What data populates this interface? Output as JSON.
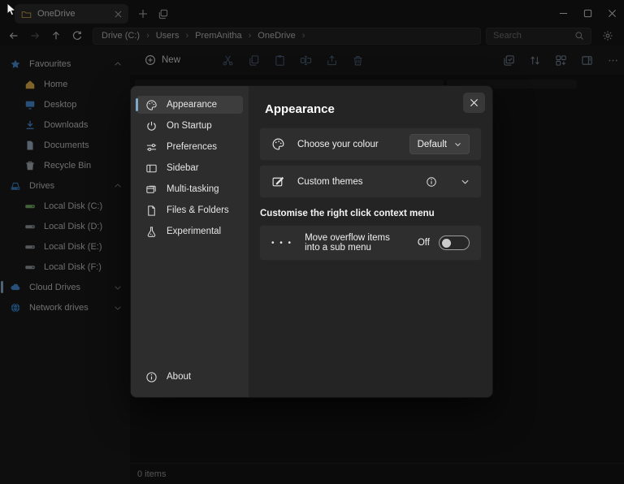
{
  "titlebar": {
    "tab_title": "OneDrive"
  },
  "addressbar": {
    "breadcrumb": {
      "items": [
        "Drive (C:)",
        "Users",
        "PremAnitha",
        "OneDrive"
      ],
      "separator": "›"
    },
    "search": {
      "placeholder": "Search"
    }
  },
  "toolbar": {
    "new_label": "New"
  },
  "sidebar": {
    "favourites": {
      "label": "Favourites",
      "items": [
        {
          "label": "Home"
        },
        {
          "label": "Desktop"
        },
        {
          "label": "Downloads"
        },
        {
          "label": "Documents"
        },
        {
          "label": "Recycle Bin"
        }
      ]
    },
    "drives": {
      "label": "Drives",
      "items": [
        {
          "label": "Local Disk (C:)"
        },
        {
          "label": "Local Disk (D:)"
        },
        {
          "label": "Local Disk (E:)"
        },
        {
          "label": "Local Disk (F:)"
        }
      ]
    },
    "cloud": {
      "label": "Cloud Drives"
    },
    "network": {
      "label": "Network drives"
    }
  },
  "statusbar": {
    "count": "0 items"
  },
  "settings": {
    "nav": {
      "items": [
        {
          "label": "Appearance",
          "selected": true
        },
        {
          "label": "On Startup",
          "selected": false
        },
        {
          "label": "Preferences",
          "selected": false
        },
        {
          "label": "Sidebar",
          "selected": false
        },
        {
          "label": "Multi-tasking",
          "selected": false
        },
        {
          "label": "Files & Folders",
          "selected": false
        },
        {
          "label": "Experimental",
          "selected": false
        }
      ],
      "about_label": "About"
    },
    "title": "Appearance",
    "rows": {
      "colour": {
        "label": "Choose your colour",
        "value": "Default"
      },
      "themes": {
        "label": "Custom themes"
      }
    },
    "context_section": {
      "label": "Customise the right click context menu",
      "toggle_row": {
        "label": "Move overflow items into a sub menu",
        "state": "Off",
        "dots_glyph": "• • •"
      }
    }
  },
  "colors": {
    "accent_pill": "#7fa7c7",
    "home_icon": "#e9b44c",
    "folder_blue": "#4a90d9",
    "disk_c_green": "#79b56a",
    "disk_gray": "#9aa0a6"
  }
}
